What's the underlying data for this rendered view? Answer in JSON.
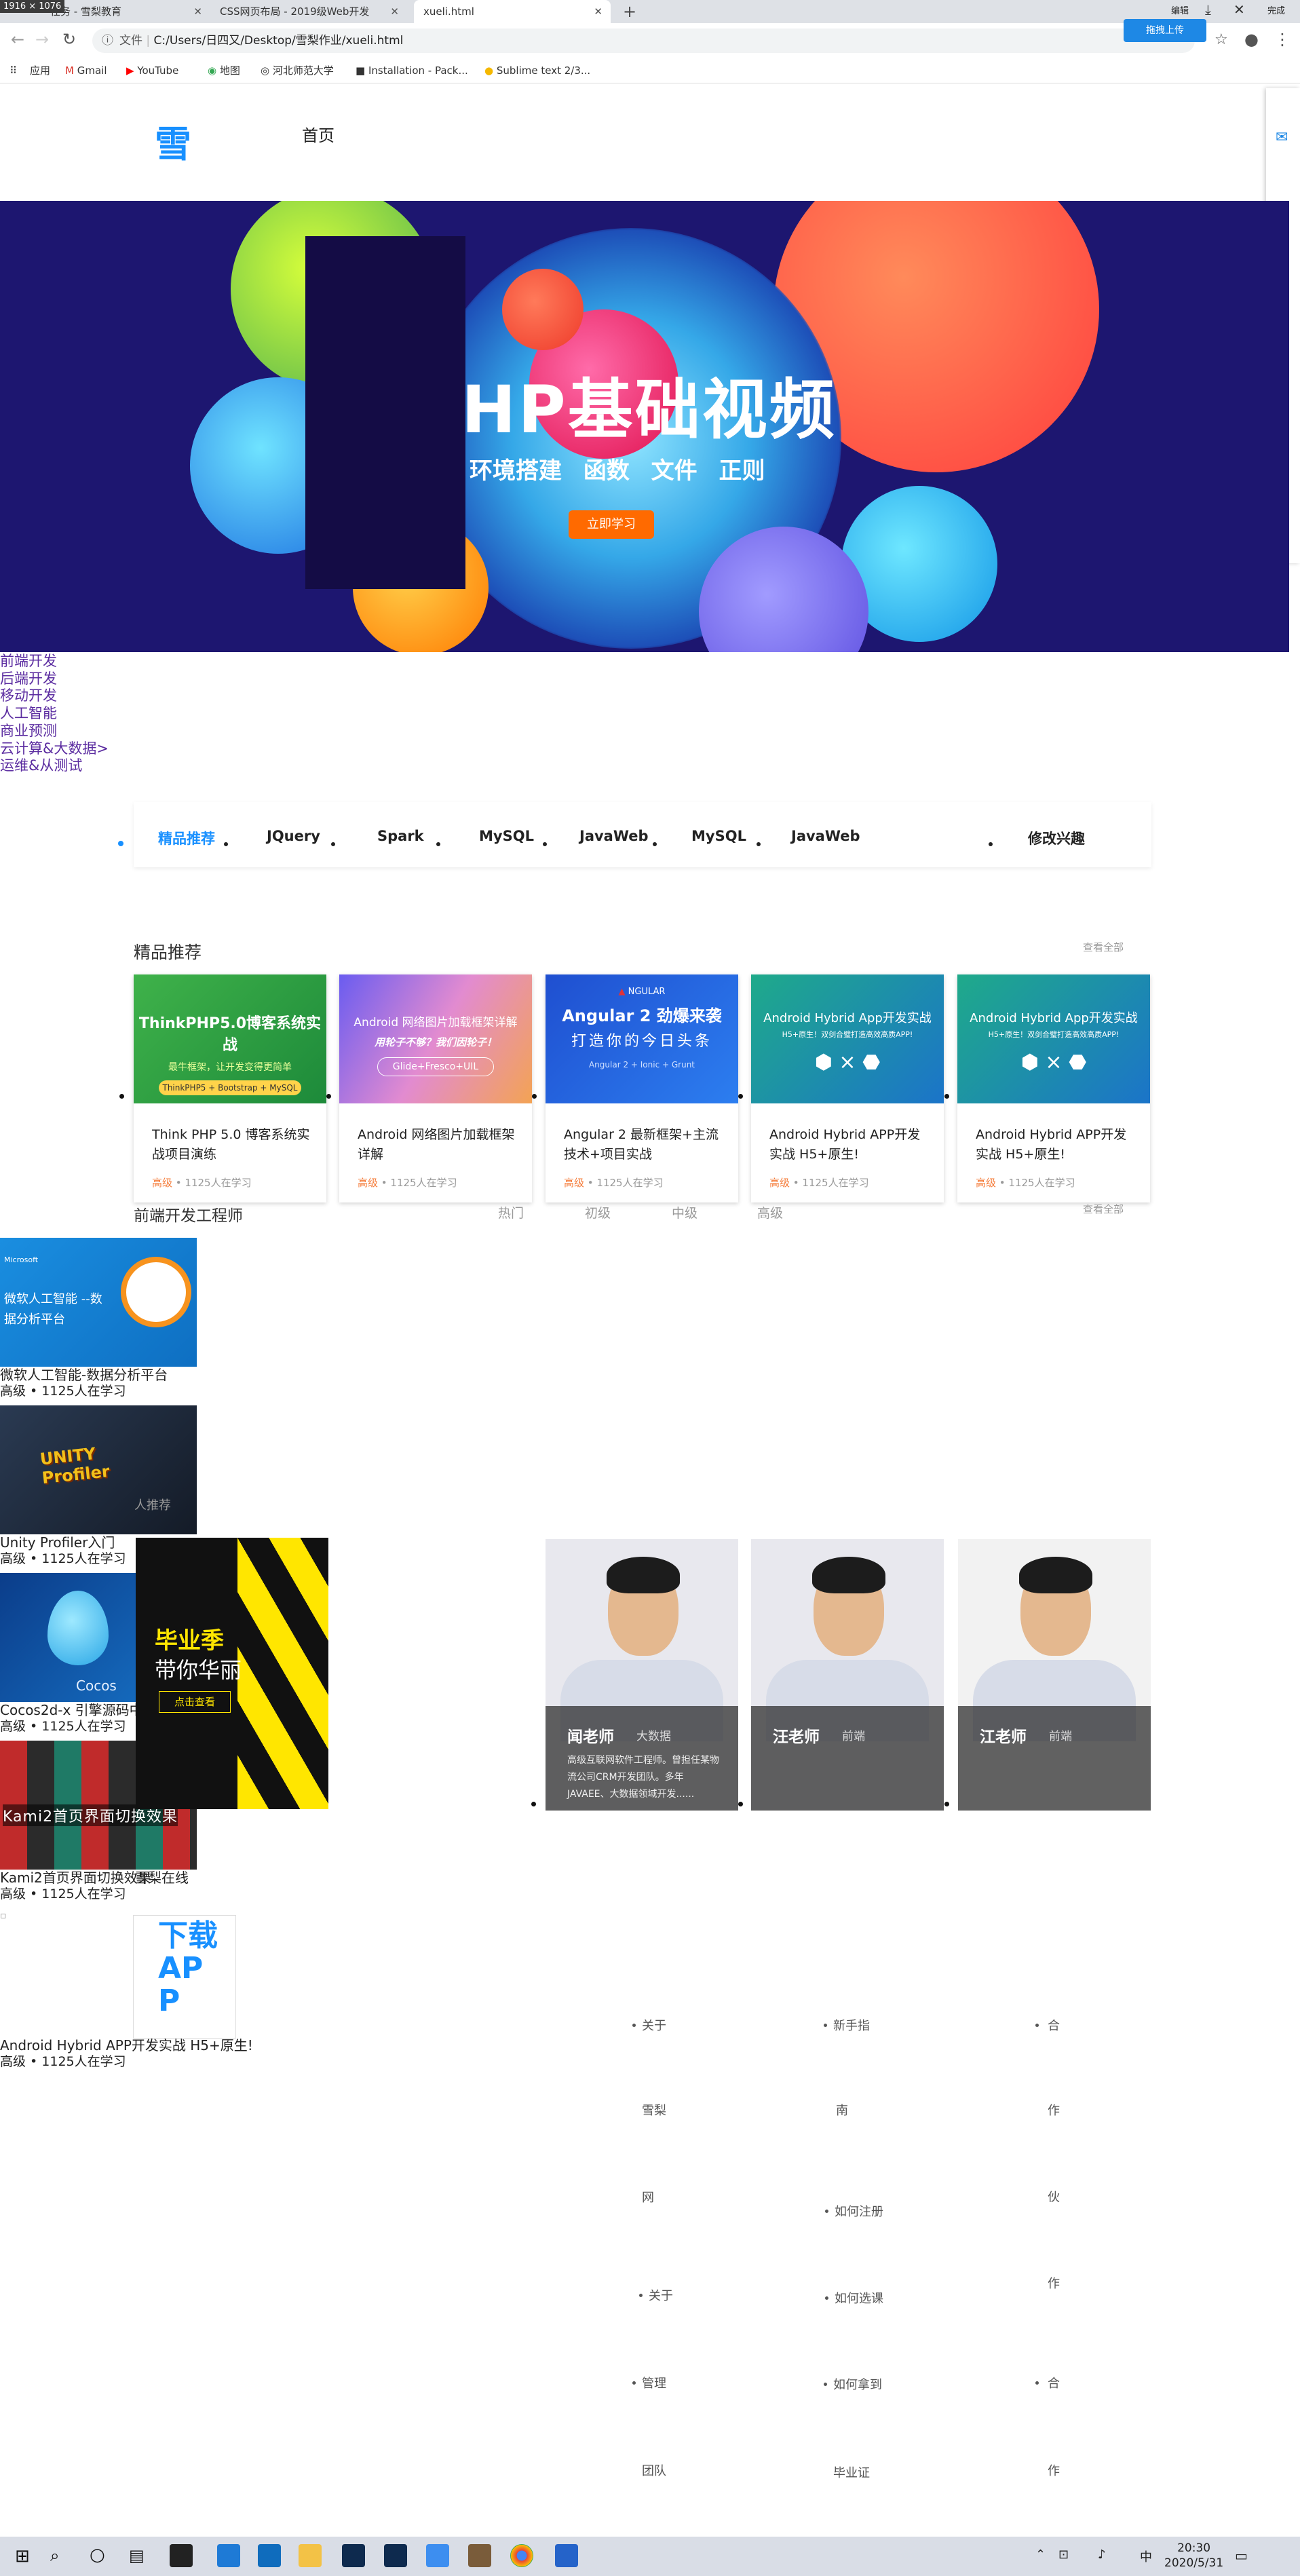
{
  "browser": {
    "dimension_badge": "1916 × 1076",
    "tabs": [
      {
        "label": "任务 - 雪梨教育"
      },
      {
        "label": "CSS网页布局 - 2019级Web开发"
      },
      {
        "label": "xueli.html"
      }
    ],
    "new_tab": "+",
    "address": "C:/Users/日四又/Desktop/雪梨作业/xueli.html",
    "address_prefix": "文件",
    "upload_label": "拖拽上传",
    "edit_label": "编辑",
    "done_label": "完成",
    "bookmarks": [
      "应用",
      "Gmail",
      "YouTube",
      "地图",
      "河北师范大学",
      "Installation - Pack...",
      "Sublime text 2/3..."
    ]
  },
  "nav": {
    "logo": "雪",
    "home": "首页"
  },
  "banner": {
    "title": "HP基础视频",
    "subtitle": "环境搭建 函数 文件 正则",
    "button": "立即学习"
  },
  "categories": [
    "前端开发",
    "后端开发",
    "移动开发",
    "人工智能",
    "商业预测",
    "云计算&大数据>",
    "运维&从测试"
  ],
  "filter": {
    "items": [
      "精品推荐",
      "JQuery",
      "Spark",
      "MySQL",
      "JavaWeb",
      "MySQL",
      "JavaWeb"
    ],
    "edit": "修改兴趣"
  },
  "featured": {
    "title": "精品推荐",
    "see_all": "查看全部",
    "cards": [
      {
        "img_title": "ThinkPHP5.0博客系统实战",
        "img_sub": "最牛框架，让开发变得更简单",
        "img_tag": "ThinkPHP5 + Bootstrap + MySQL",
        "title": "Think PHP 5.0 博客系统实战项目演练",
        "level": "高级",
        "meta": " • 1125人在学习"
      },
      {
        "img_title": "Android 网络图片加载框架详解",
        "img_sub": "用轮子不够？我们因轮子！",
        "img_tag": "Glide+Fresco+UIL",
        "title": "Android 网络图片加载框架详解",
        "level": "高级",
        "meta": " • 1125人在学习"
      },
      {
        "img_title": "Angular 2 劲爆来袭",
        "img_sub": "打造你的今日头条",
        "img_tag": "Angular 2 + Ionic + Grunt",
        "title": "Angular 2 最新框架+主流技术+项目实战",
        "level": "高级",
        "meta": " • 1125人在学习"
      },
      {
        "img_title": "Android Hybrid App开发实战",
        "img_sub": "H5+原生！双剑合璧打造高效高质APP!",
        "img_tag": "",
        "title": "Android Hybrid APP开发实战 H5+原生!",
        "level": "高级",
        "meta": " • 1125人在学习"
      },
      {
        "img_title": "Android Hybrid App开发实战",
        "img_sub": "H5+原生！双剑合璧打造高效高质APP!",
        "img_tag": "",
        "title": "Android Hybrid APP开发实战 H5+原生!",
        "level": "高级",
        "meta": " • 1125人在学习"
      }
    ]
  },
  "frontend": {
    "title": "前端开发工程师",
    "tabs": [
      "热门",
      "初级",
      "中级",
      "高级"
    ],
    "see_all": "查看全部",
    "courses": [
      {
        "img_label": "微软人工智能 --数据分析平台",
        "brand": "Microsoft",
        "title": "微软人工智能-数据分析平台",
        "meta": "高级 • 1125人在学习"
      },
      {
        "img_label": "UNITY Profiler",
        "title": "Unity Profiler入门",
        "meta": "高级 • 1125人在学习"
      },
      {
        "img_label": "Cocos",
        "title": "Cocos2d-x 引擎源码中",
        "meta": "高级 • 1125人在学习"
      },
      {
        "img_label": "Kami2首页界面切换效果",
        "title": "Kami2首页界面切换效果",
        "meta": "高级 • 1125人在学习"
      },
      {
        "img_label": "",
        "title": "Android Hybrid APP开发实战 H5+原生!",
        "meta": "高级 • 1125人在学习"
      }
    ],
    "overlap_label": "人推荐",
    "overlap_label2": "雪梨在线",
    "promo": {
      "line1": "毕业季",
      "line2": "带你华丽",
      "btn": "点击查看"
    },
    "download_app": "下载APP"
  },
  "teachers": [
    {
      "name": "闻老师",
      "role": "大数据",
      "desc": "高级互联网软件工程师。曾担任某物流公司CRM开发团队。多年JAVAEE、大数据领域开发......"
    },
    {
      "name": "汪老师",
      "role": "前端",
      "desc": ""
    },
    {
      "name": "江老师",
      "role": "前端",
      "desc": ""
    }
  ],
  "footer": {
    "col1": [
      "关于",
      "雪梨",
      "网",
      "关于",
      "管理",
      "团队"
    ],
    "col2": [
      "新手指",
      "南",
      "如何注册",
      "如何选课",
      "如何拿到",
      "毕业证"
    ],
    "col3": [
      "合",
      "作",
      "伙",
      "作",
      "合",
      "作"
    ]
  },
  "taskbar": {
    "time": "20:30",
    "date": "2020/5/31",
    "ime": "中"
  }
}
